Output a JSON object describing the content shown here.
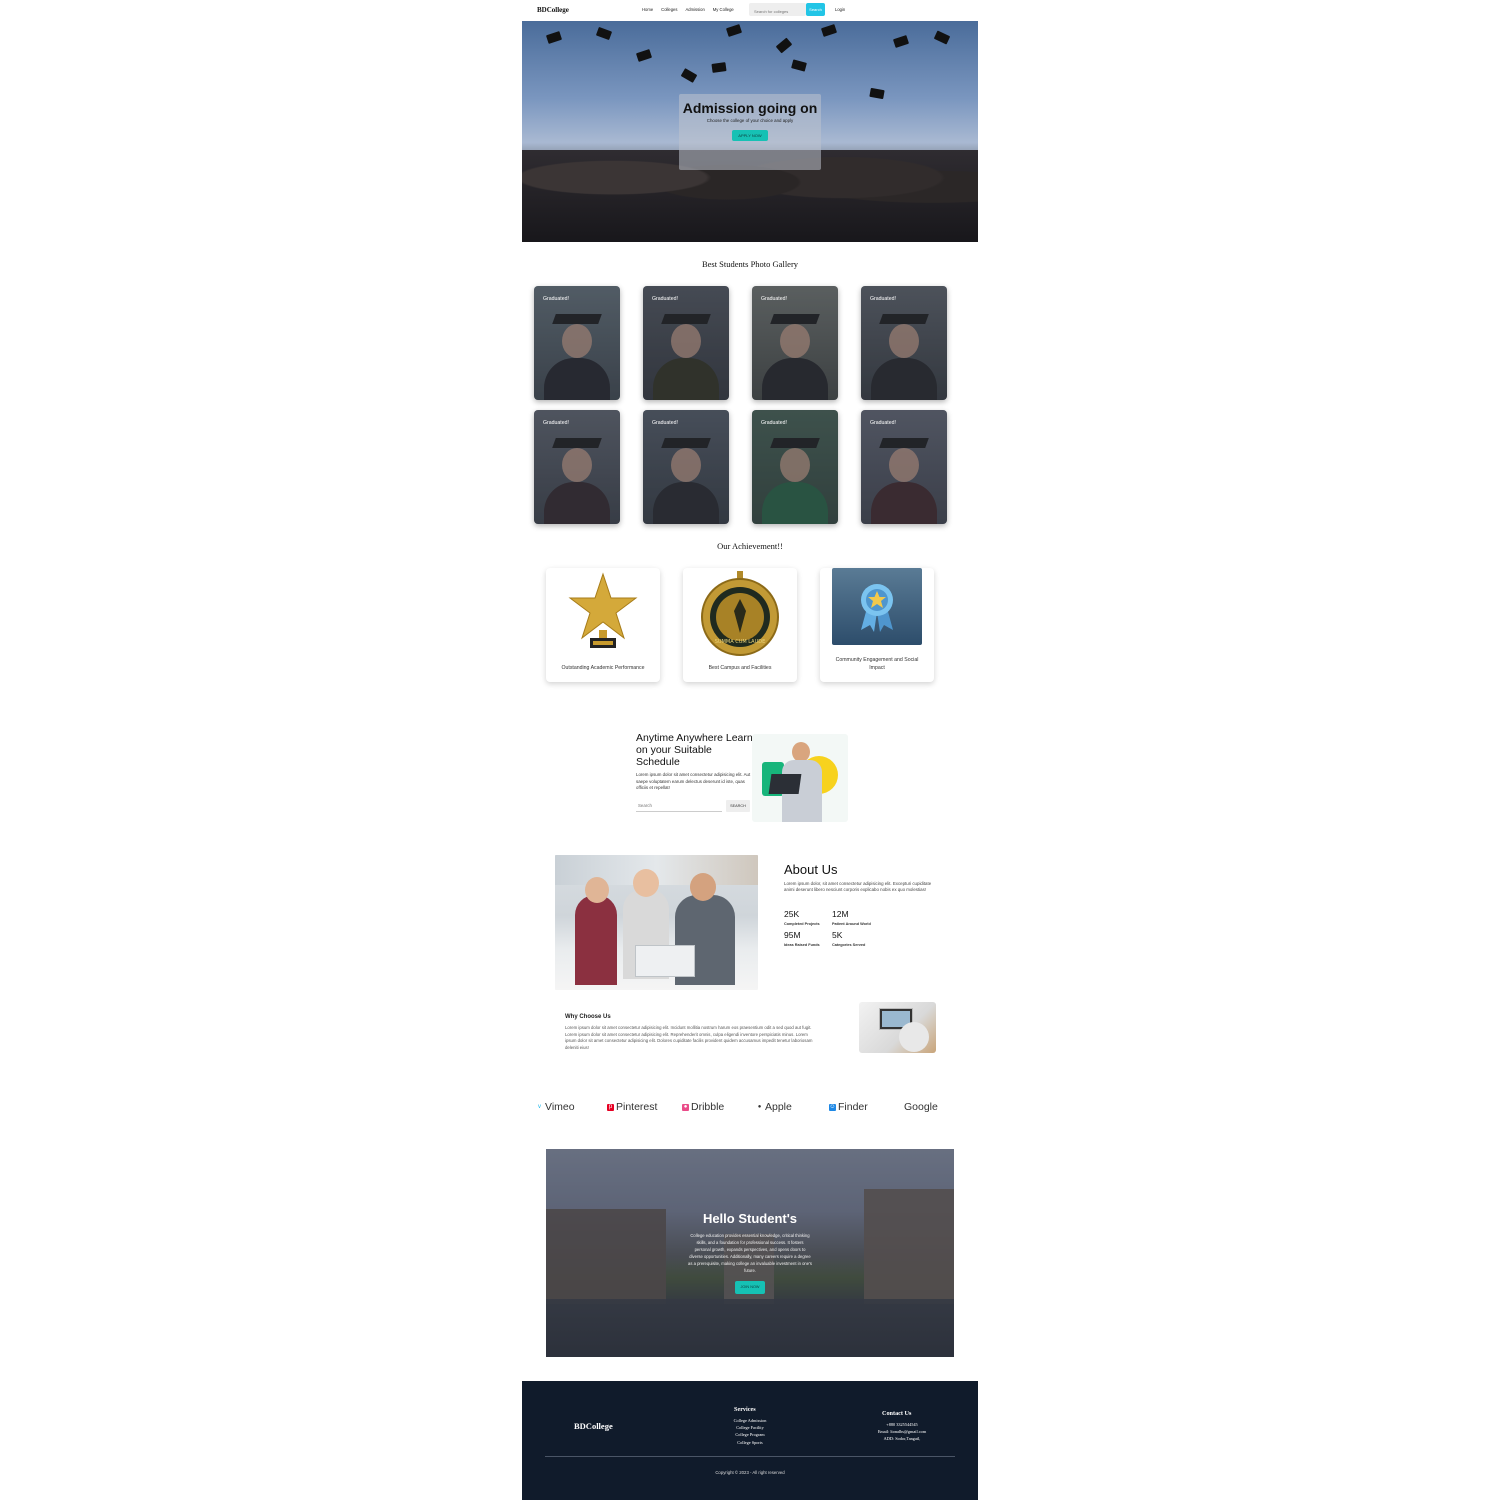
{
  "nav": {
    "brand": "BDCollege",
    "links": [
      "Home",
      "Colleges",
      "Admission",
      "My College"
    ],
    "search_placeholder": "Search for colleges",
    "search_button": "Search",
    "login": "Login"
  },
  "hero": {
    "title": "Admission going on",
    "subtitle": "Choose the college of your choice and apply",
    "button": "APPLY NOW"
  },
  "gallery": {
    "title": "Best Students Photo Gallery",
    "items": [
      {
        "label": "Graduated!"
      },
      {
        "label": "Graduated!"
      },
      {
        "label": "Graduated!"
      },
      {
        "label": "Graduated!"
      },
      {
        "label": "Graduated!"
      },
      {
        "label": "Graduated!"
      },
      {
        "label": "Graduated!"
      },
      {
        "label": "Graduated!"
      }
    ]
  },
  "achievements": {
    "title": "Our Achievement!!",
    "items": [
      {
        "label": "Outstanding Academic Performance",
        "icon": "gold-star-trophy-icon"
      },
      {
        "label": "Best Campus and Facilities",
        "icon": "gold-medal-icon"
      },
      {
        "label": "Community Engagement and Social Impact",
        "icon": "award-ribbon-icon"
      }
    ],
    "medal_text": "SUMMA CUM LAUDE"
  },
  "learn": {
    "title": "Anytime Anywhere Learn on your Suitable Schedule",
    "text": "Lorem ipsum dolor sit amet consectetur adipisicing elit. Aut saepe voluptatem earum delectus deserunt id iste, quas officiis et repellat!",
    "search_placeholder": "Search",
    "search_button": "SEARCH"
  },
  "about": {
    "title": "About Us",
    "text": "Lorem ipsum dolor, sit amet consectetur adipisicing elit. Excepturi cupiditate animi deserunt libero nesciunt corporis explicabo nobis ex quo molestias!",
    "stats": [
      {
        "value": "25K",
        "label": "Completed Projects"
      },
      {
        "value": "12M",
        "label": "Patient Around World"
      },
      {
        "value": "95M",
        "label": "Ideas Raised Funds"
      },
      {
        "value": "5K",
        "label": "Categories Served"
      }
    ]
  },
  "why": {
    "title": "Why Choose Us",
    "text": "Lorem ipsum dolor sit amet consectetur adipisicing elit. Incidunt mollitia nostrum harum eos praesentium odit a sed quod aut fugit. Lorem ipsum dolor sit amet consectetur adipisicing elit. Reprehenderit omnis, culpa eligendi inventore perspiciatis minus. Lorem ipsum dolor sit amet consectetur adipisicing elit. Dolores cupiditate facilis provident quidem accusamus impedit tenetur laboriosam deleniti eius!"
  },
  "brands": [
    {
      "name": "Vimeo",
      "icon": "vimeo-icon",
      "color": "#1ab7ea"
    },
    {
      "name": "Pinterest",
      "icon": "pinterest-icon",
      "color": "#e60023"
    },
    {
      "name": "Dribble",
      "icon": "dribbble-icon",
      "color": "#ea4c89"
    },
    {
      "name": "Apple",
      "icon": "apple-icon",
      "color": "#333333"
    },
    {
      "name": "Finder",
      "icon": "finder-icon",
      "color": "#1e88e5"
    },
    {
      "name": "Google",
      "icon": "",
      "color": "#333333"
    }
  ],
  "hello": {
    "title": "Hello Student's",
    "text": "College education provides essential knowledge, critical thinking skills, and a foundation for professional success. It fosters personal growth, expands perspectives, and opens doors to diverse opportunities. Additionally, many careers require a degree as a prerequisite, making college an invaluable investment in one's future.",
    "button": "JOIN NOW"
  },
  "footer": {
    "brand": "BDCollege",
    "services_title": "Services",
    "services": [
      "College Admission",
      "College Facility",
      "College Program",
      "College Sports"
    ],
    "contact_title": "Contact Us",
    "contact": [
      "+880 3325544545",
      "Email: ltonalbs@gmail.com",
      "ADD: Sodor,Tangail,"
    ],
    "copyright": "Copyright © 2023 - All right reserved"
  },
  "colors": {
    "accent": "#16c1b4",
    "search_button": "#22c5e6",
    "footer_bg": "#101b2b"
  }
}
